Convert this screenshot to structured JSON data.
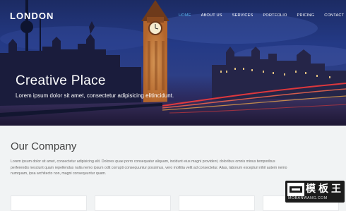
{
  "nav": {
    "logo": "LONDON",
    "items": [
      {
        "label": "HOME",
        "active": true
      },
      {
        "label": "ABOUT US",
        "active": false
      },
      {
        "label": "SERVICES",
        "active": false
      },
      {
        "label": "PORTFOLIO",
        "active": false
      },
      {
        "label": "PRICING",
        "active": false
      },
      {
        "label": "CONTACT",
        "active": false
      }
    ]
  },
  "hero": {
    "title": "Creative Place",
    "subtitle": "Lorem ipsum dolor sit amet, consectetur adipisicing elitincidunt."
  },
  "company": {
    "title": "Our Company",
    "lines": [
      "Lorem ipsum dolor sit amet, consectetur adipisicing elit. Dolores quae porro consequatur aliquam, incidunt eius magni provident, doloribus omnis minus temporibus",
      "perferendis nesciunt quam repellendus nulla nemo ipsum odit corrupti consequuntur possimus, vero mollitia velit ad consectetur. Alias, laborum excepturi nihil autem nemo",
      "numquam, ipsa architecto non, magni consequuntur quam."
    ]
  },
  "watermark": {
    "text": "模板王",
    "url": "MOBANWANG.COM"
  },
  "colors": {
    "nav_active": "#5ab4f0",
    "hero_sky": "#243a86",
    "body_background": "#f1f3f4"
  }
}
